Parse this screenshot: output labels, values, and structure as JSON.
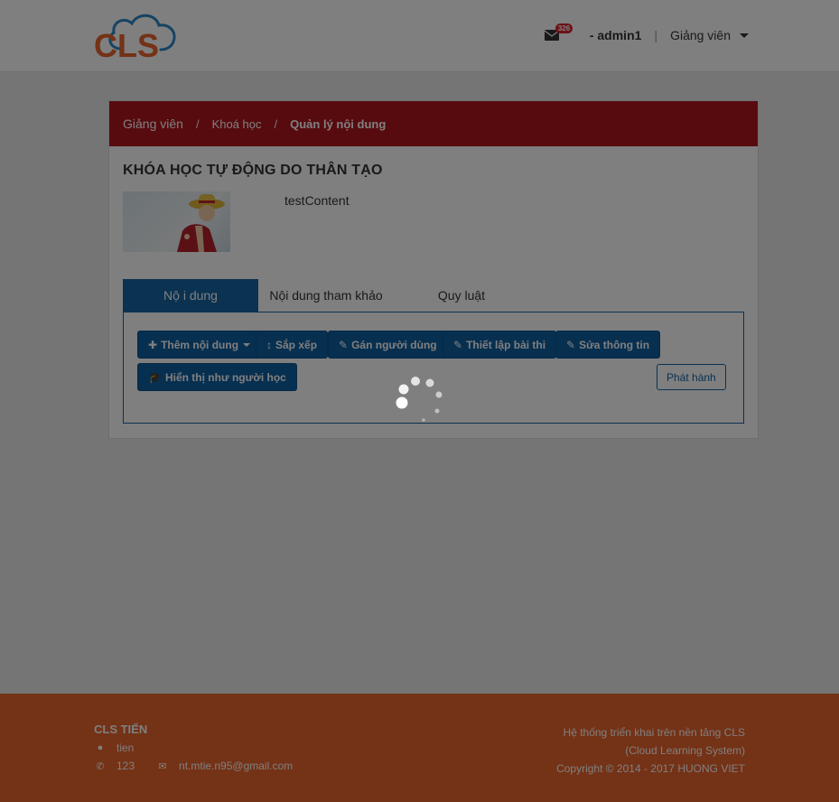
{
  "header": {
    "logo_text": "CLS",
    "mail_count": "326",
    "username": "- admin1",
    "separator": "|",
    "role": "Giảng viên"
  },
  "breadcrumb": {
    "items": [
      "Giảng viên",
      "Khoá học",
      "Quản lý nội dung"
    ],
    "separator": "/"
  },
  "course": {
    "title": "KHÓA HỌC TỰ ĐỘNG DO THÂN TẠO",
    "description": "testContent"
  },
  "tabs": [
    {
      "label": "Nộ i dung"
    },
    {
      "label": "Nội dung tham khảo"
    },
    {
      "label": "Quy luật"
    }
  ],
  "toolbar": {
    "add_content": "Thêm nội dung",
    "sort": "Sắp xếp",
    "assign_users": "Gán người dùng",
    "exam_setup": "Thiết lập bài thi",
    "edit_info": "Sửa thông tin",
    "view_as_learner": "Hiển thị như người học",
    "publish": "Phát hành"
  },
  "footer": {
    "brand": "CLS TIẾN",
    "address": "tien",
    "phone": "123",
    "email": "nt.mtie.n95@gmail.com",
    "right_line1": "Hệ thống triển khai trên nền tảng CLS",
    "right_line2": "(Cloud Learning System)",
    "right_line3": "Copyright © 2014 - 2017 HUONG VIET"
  },
  "colors": {
    "brand_orange": "#e8642c",
    "brand_blue": "#1765a2",
    "breadcrumb_red": "#b0161e"
  }
}
